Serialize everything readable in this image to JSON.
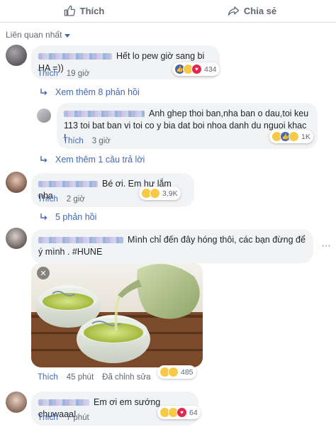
{
  "actions": {
    "like": "Thích",
    "share": "Chia sẻ"
  },
  "sort_label": "Liên quan nhất",
  "comments": [
    {
      "text": "Hết lo pew giờ sang bi HA =))",
      "like": "Thích",
      "time": "19 giờ",
      "reactions": [
        "like",
        "haha",
        "love"
      ],
      "count": "434"
    },
    {
      "text": "Anh ghep thoi ban,nha ban o dau,toi keu 113 toi bat ban vi toi co y bia dat boi nhoa danh du nguoi khac !",
      "like": "Thích",
      "time": "3 giờ",
      "reactions": [
        "haha",
        "like",
        "sad"
      ],
      "count": "1K"
    },
    {
      "text": "Bé ơi. Em hư lắm nha",
      "like": "Thích",
      "time": "2 giờ",
      "reactions": [
        "haha",
        "sad"
      ],
      "count": "3,9K"
    },
    {
      "text": "Mình chỉ đến đây hóng thôi, các bạn đừng để ý mình . #HUNE",
      "like": "Thích",
      "time": "45 phút",
      "edited": "Đã chỉnh sửa",
      "reactions": [
        "haha",
        "sad"
      ],
      "count": "485"
    },
    {
      "text": "Em ơi em sướng chuwaaa!",
      "like": "Thích",
      "time": "7 phút",
      "reactions": [
        "haha",
        "sad",
        "love"
      ],
      "count": "64"
    }
  ],
  "view_more_replies": "Xem thêm 8 phản hồi",
  "view_more_answer": "Xem thêm 1 câu trả lời",
  "replies_count": "5 phản hồi",
  "colors": {
    "accent": "#4267b2",
    "bubble": "#f2f3f5",
    "meta": "#606770"
  }
}
